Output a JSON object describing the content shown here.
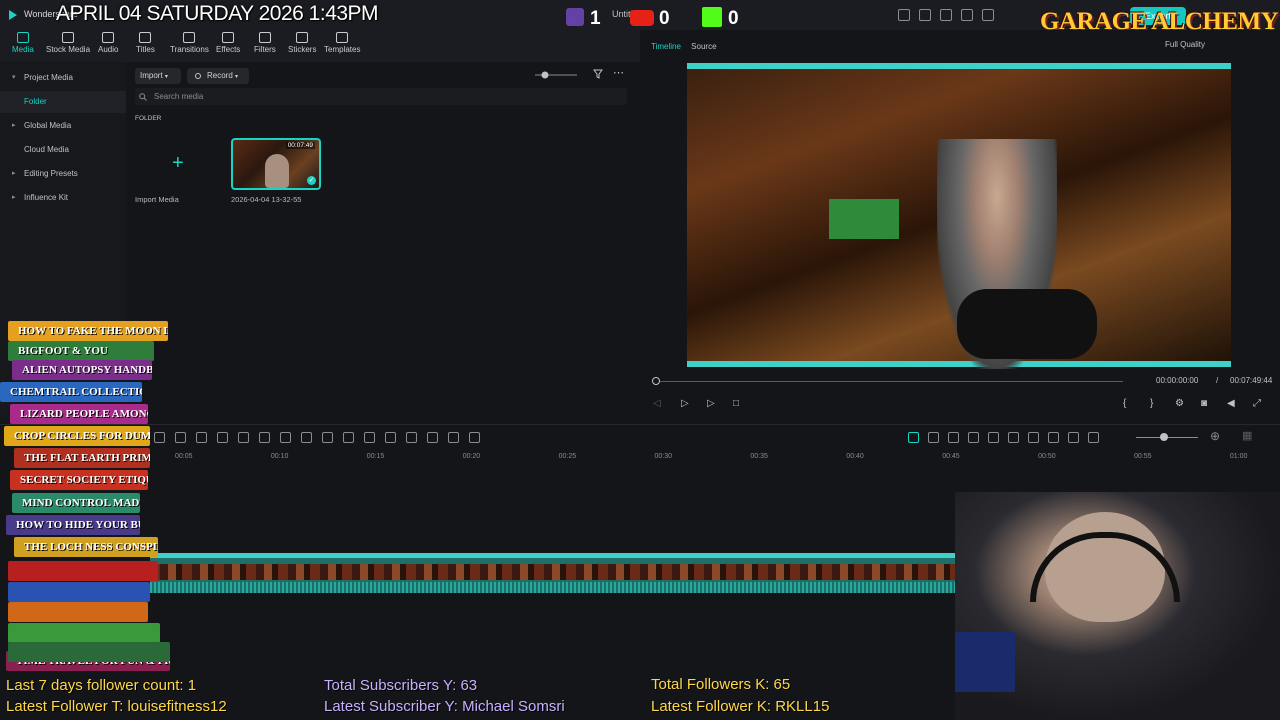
{
  "titlebar": {
    "app_name": "Wondershare",
    "project_name": "Untitled",
    "export_label": "Export",
    "overlay_date": "APRIL 04 SATURDAY 2026 1:43PM",
    "twitch_count": "1",
    "youtube_count": "0",
    "kick_count": "0",
    "garage_logo": "GARAGE ALCHEMY"
  },
  "tabs": [
    {
      "label": "Media",
      "icon": "media-icon"
    },
    {
      "label": "Stock Media",
      "icon": "stock-media-icon"
    },
    {
      "label": "Audio",
      "icon": "audio-icon"
    },
    {
      "label": "Titles",
      "icon": "titles-icon"
    },
    {
      "label": "Transitions",
      "icon": "transitions-icon"
    },
    {
      "label": "Effects",
      "icon": "effects-icon"
    },
    {
      "label": "Filters",
      "icon": "filters-icon"
    },
    {
      "label": "Stickers",
      "icon": "stickers-icon"
    },
    {
      "label": "Templates",
      "icon": "templates-icon"
    }
  ],
  "sidebar": {
    "items": [
      {
        "label": "Project Media"
      },
      {
        "label": "Folder"
      },
      {
        "label": "Global Media"
      },
      {
        "label": "Cloud Media"
      },
      {
        "label": "Editing Presets"
      },
      {
        "label": "Influence Kit"
      }
    ]
  },
  "media": {
    "import_label": "Import",
    "record_label": "Record",
    "search_placeholder": "Search media",
    "folder_label": "FOLDER",
    "import_media_label": "Import Media",
    "clip_name": "2026-04-04 13-32-55",
    "clip_duration": "00:07:49"
  },
  "player": {
    "tab_timeline": "Timeline",
    "tab_source": "Source",
    "quality": "Full Quality",
    "time_current": "00:00:00:00",
    "time_sep": "/",
    "time_total": "00:07:49:44"
  },
  "timeline": {
    "ticks": [
      "00:05",
      "00:10",
      "00:15",
      "00:20",
      "00:25",
      "00:30",
      "00:35",
      "00:40",
      "00:45",
      "00:50",
      "00:55",
      "01:00"
    ]
  },
  "books": [
    "HOW TO FAKE THE MOON LANDING",
    "BIGFOOT & YOU",
    "ALIEN AUTOPSY HANDBOOK",
    "CHEMTRAIL COLLECTION GUIDE",
    "LIZARD PEOPLE AMONG US",
    "CROP CIRCLES FOR DUMMIES",
    "THE FLAT EARTH PRIMER",
    "SECRET SOCIETY ETIQUETTE",
    "MIND CONTROL MADE EASY",
    "HOW TO HIDE YOUR BUNKER",
    "THE LOCH NESS CONSPIRACY",
    "TIME TRAVEL FOR FUN & PROFIT"
  ],
  "stats": {
    "follower_count": "Last 7 days follower count: 1",
    "latest_follower_t": "Latest Follower T: louisefitness12",
    "total_subscribers_y": "Total Subscribers Y: 63",
    "latest_subscriber_y": "Latest Subscriber Y: Michael Somsri",
    "total_followers_k": "Total Followers K: 65",
    "latest_follower_k": "Latest Follower K: RKLL15"
  }
}
